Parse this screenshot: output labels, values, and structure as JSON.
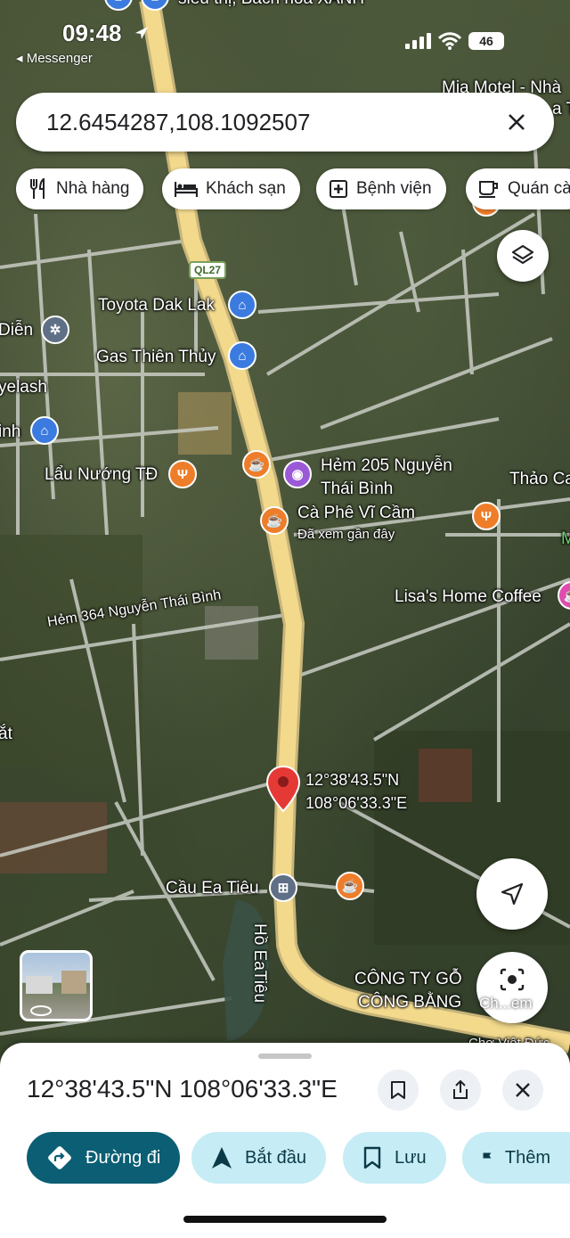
{
  "status_bar": {
    "time": "09:48",
    "back_app": "◂ Messenger",
    "battery": "46"
  },
  "search": {
    "value": "12.6454287,108.1092507",
    "clear_icon": "close-icon"
  },
  "chips": [
    {
      "icon": "restaurant-icon",
      "label": "Nhà hàng"
    },
    {
      "icon": "hotel-icon",
      "label": "Khách sạn"
    },
    {
      "icon": "hospital-icon",
      "label": "Bệnh viện"
    },
    {
      "icon": "coffee-icon",
      "label": "Quán cà"
    }
  ],
  "map": {
    "road_badge": "QL27",
    "labels": {
      "top_partial": "siêu thị, Bách hóa XANH",
      "mia_motel": "Mia Motel - Nhà",
      "mia_motel_2": "a T",
      "toyota": "Toyota Dak Lak",
      "dien": "Diễn",
      "gas": "Gas Thiên Thủy",
      "eyelash": "yelash",
      "inh": "inh",
      "lau_nuong": "Lẩu Nướng TĐ",
      "hem205_1": "Hẻm 205 Nguyễn",
      "hem205_2": "Thái Bình",
      "thao_ca": "Thảo Ca",
      "ca_phe": "Cà Phê Vĩ Cầm",
      "ca_phe_sub": "Đã xem gần đây",
      "lisas": "Lisa's Home Coffee",
      "m": "M",
      "hem364": "Hẻm 364 Nguyễn Thái Bình",
      "at": "ắt",
      "pin_lat": "12°38'43.5\"N",
      "pin_lng": "108°06'33.3\"E",
      "cau_ea_tieu": "Cầu Ea Tiêu",
      "ho_ea_tieu": "Hồ EaTiêu",
      "cong_ty_1": "CÔNG TY GỖ",
      "cong_ty_2": "CÔNG BẰNG",
      "bottom_partial": "Chợ Việt Đức"
    }
  },
  "buttons": {
    "layers_icon": "layers-icon",
    "location_icon": "navigation-arrow-icon",
    "lens_icon": "camera-lens-icon",
    "lens_label": "Ch...em"
  },
  "sheet": {
    "title": "12°38'43.5\"N 108°06'33.3\"E",
    "save_icon": "bookmark-icon",
    "share_icon": "share-icon",
    "close_icon": "close-icon",
    "actions": [
      {
        "icon": "directions-icon",
        "label": "Đường đi"
      },
      {
        "icon": "navigation-arrow-icon",
        "label": "Bắt đầu"
      },
      {
        "icon": "bookmark-icon",
        "label": "Lưu"
      },
      {
        "icon": "flag-icon",
        "label": "Thêm"
      }
    ]
  },
  "colors": {
    "primary_action": "#0b5e73",
    "secondary_action": "#c6ecf5",
    "road": "#f2d98c",
    "pin": "#e53935"
  }
}
